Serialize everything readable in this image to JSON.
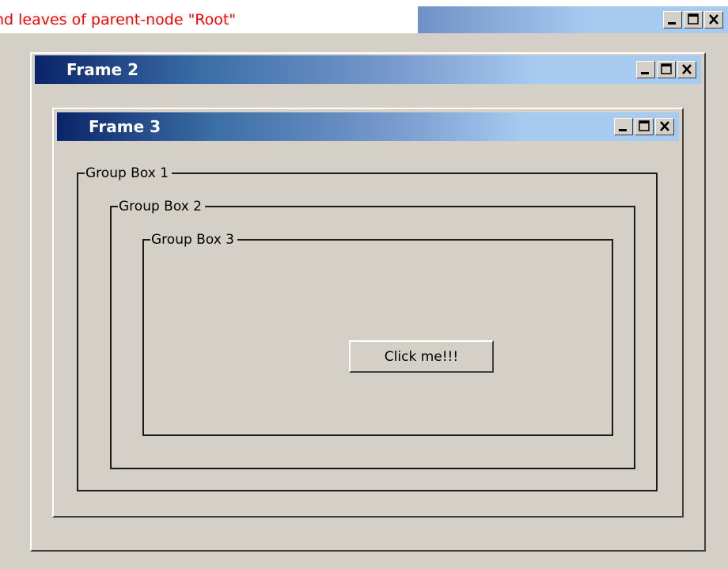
{
  "tooltip": {
    "text": "nd leaves of parent-node \"Root\""
  },
  "frames": [
    {
      "title": "Frame 2"
    },
    {
      "title": "Frame 3"
    }
  ],
  "group_boxes": [
    {
      "label": "Group Box 1"
    },
    {
      "label": "Group Box 2"
    },
    {
      "label": "Group Box 3"
    }
  ],
  "button": {
    "label": "Click me!!!"
  },
  "colors": {
    "tooltip_text": "#ff0000",
    "titlebar_dark": "#0a246a",
    "titlebar_light": "#a6caf0",
    "face": "#d4d0c8"
  },
  "icons": [
    "minimize-icon",
    "maximize-icon",
    "close-icon"
  ]
}
